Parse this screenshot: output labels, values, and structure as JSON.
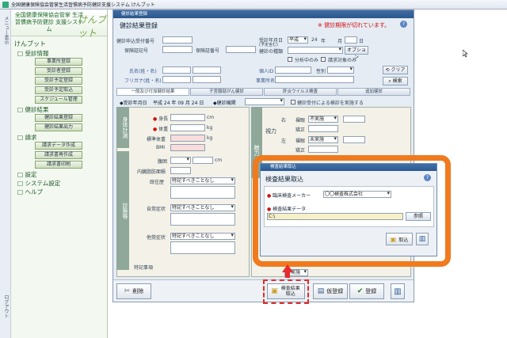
{
  "app": {
    "title": "全国健康保険協会管掌生活習慣病予防健診支援システム けんブット"
  },
  "strip": {
    "top_label": "メニュー表示",
    "bottom_label": "ログアウト"
  },
  "sidebar": {
    "header_text": "全国健康保険協会管掌 生活習慣病予防健診 支援システム",
    "logo": "けんブット",
    "top_label": "けんブット",
    "sections": [
      {
        "label": "受診情報",
        "items": [
          "事業所登録",
          "受診者登録",
          "受診予定登録",
          "受診予定取込",
          "スケジュール管理"
        ]
      },
      {
        "label": "健診結果",
        "items": [
          "健診結果登録",
          "健診結果出力"
        ]
      },
      {
        "label": "請求",
        "items": [
          "請求データ作成",
          "請求書再作成",
          "請求書印刷"
        ]
      },
      {
        "label": "設定",
        "items": []
      },
      {
        "label": "システム設定",
        "items": []
      },
      {
        "label": "ヘルプ",
        "items": []
      }
    ]
  },
  "main": {
    "window_title": "健診結果登録",
    "heading": "健診結果登録",
    "warning": "※ 健診期限が切れています。",
    "form": {
      "card_no_label": "健診申込受付番号",
      "insurer_label": "保険証記号",
      "insurer_no_label": "保険証番号",
      "exam_type_label": "健診の種類",
      "date_label": "受診年月日",
      "date_sub_label": "(予定含む)",
      "era": "平成",
      "year": "24",
      "year_unit": "年",
      "month_unit": "月",
      "day_unit": "日",
      "option_label": "オプション",
      "chk1_label": "分析中のみ",
      "chk2_label": "請求対象のみ",
      "name_label": "氏名(姓・名)",
      "kana_label": "フリガナ(姓・名)",
      "personal_id_label": "個人ID",
      "gender_label": "性別",
      "office_label": "事業所名",
      "clear_label": "クリア",
      "search_label": "検索"
    },
    "tabs": [
      "一般及び付加健診結果",
      "子宮頸部がん健診",
      "肝炎ウイルス検査",
      "追加健診"
    ],
    "subheader": {
      "date_label": "受診年月日",
      "date_value": "平成 24 年 09 月 24 日",
      "exam_place_label": "健診機関",
      "chk_label": "健診受付による検診を実施する"
    },
    "left_panel": {
      "section1": "身体計測",
      "height_label": "身長",
      "height_unit": "cm",
      "weight_label": "体重",
      "weight_unit": "kg",
      "std_weight_label": "標準体重",
      "std_weight_unit": "kg",
      "bmi_label": "BMI",
      "section2": "診察等",
      "waist_label": "腹囲",
      "waist_unit": "cm",
      "internal_label": "内臓脂肪面積",
      "history_label": "既往歴",
      "subjective_label": "自覚症状",
      "objective_label": "他覚症状",
      "special_note_label": "特記事項",
      "note_value": "特記すべきことなし"
    },
    "right_panel": {
      "section": "視力",
      "right_label": "右",
      "left_label": "左",
      "naked_label": "裸眼",
      "corrected_label": "矯正",
      "naked_value_r": "不実施",
      "naked_value_l": "未実施",
      "hearing_label": "聴力",
      "value_blank": "不実施"
    },
    "bottom": {
      "delete_label": "削除",
      "import_label": "検査結果取込",
      "temp_save_label": "仮登録",
      "register_label": "登録"
    }
  },
  "popup": {
    "window_title": "検査結果取込",
    "heading": "検査結果取込",
    "maker_label": "臨床検査メーカー",
    "maker_value": "〇〇検査株式会社",
    "data_label": "検査結果データ",
    "data_value": "C:\\",
    "browse_label": "参照",
    "import_label": "取込"
  }
}
